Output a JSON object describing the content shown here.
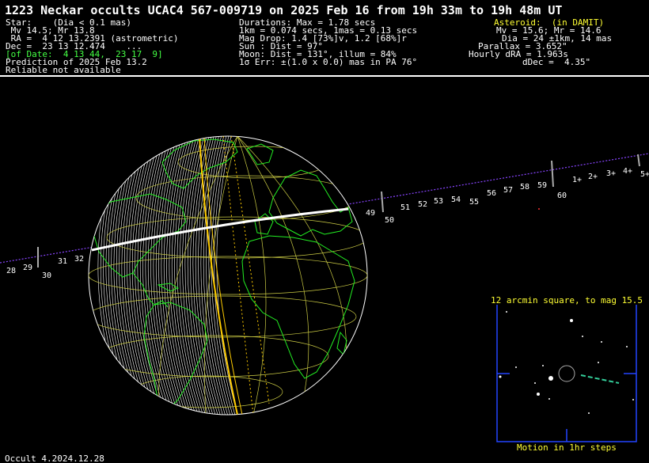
{
  "header": {
    "title": "1223 Neckar occults UCAC4 567-009719 on 2025 Feb 16 from 19h 33m to 19h 48m UT",
    "star": {
      "line1": "Star:    (Dia < 0.1 mas)",
      "line2": " Mv 14.5; Mr 13.8",
      "line3": " RA =  4 12 13.2391 (astrometric)",
      "line4": "Dec =  23 13 12.474    ...",
      "line5": "[of Date:  4 13 44,  23 17  9]",
      "line6": "Prediction of 2025 Feb 13.2",
      "line7": "Reliable not available"
    },
    "event": {
      "line1": "Durations: Max = 1.78 secs",
      "line2": "1km = 0.074 secs, 1mas = 0.13 secs",
      "line3": "Mag Drop: 1.4 [73%]v, 1.2 [68%]r",
      "line4": "Sun : Dist = 97°",
      "line5": "Moon: Dist = 131°, illum = 84%",
      "line6": "1σ Err: ±(1.0 x 0.0) mas in PA 76°"
    },
    "asteroid": {
      "line1": "Asteroid:  (in DAMIT)",
      "line2": "Mv = 15.6; Mr = 14.6",
      "line3": "Dia = 24 ±1km, 14 mas",
      "line4": "Parallax = 3.652\"",
      "line5": "Hourly dRA = 1.963s",
      "line6": "dDec =  4.35\""
    }
  },
  "path_ticks": [
    "28",
    "29",
    "30",
    "31",
    "32",
    "49",
    "50",
    "51",
    "52",
    "53",
    "54",
    "55",
    "56",
    "57",
    "58",
    "59",
    "60",
    "1+",
    "2+",
    "3+",
    "4+",
    "5+"
  ],
  "star_chart": {
    "title": "12 arcmin square, to mag 15.5",
    "caption": "Motion in 1hr steps"
  },
  "footer": {
    "version": "Occult 4.2024.12.28"
  },
  "colors": {
    "background": "#000000",
    "text": "#ffffff",
    "highlight_green": "#44ff44",
    "highlight_yellow": "#ffff33",
    "coastline": "#22ee22",
    "path": "#ffffff",
    "terminator": "#ffcc00",
    "graticule": "#cccc44",
    "track": "#8844ff",
    "chart_frame": "#2244ff",
    "motion": "#33cc99"
  }
}
